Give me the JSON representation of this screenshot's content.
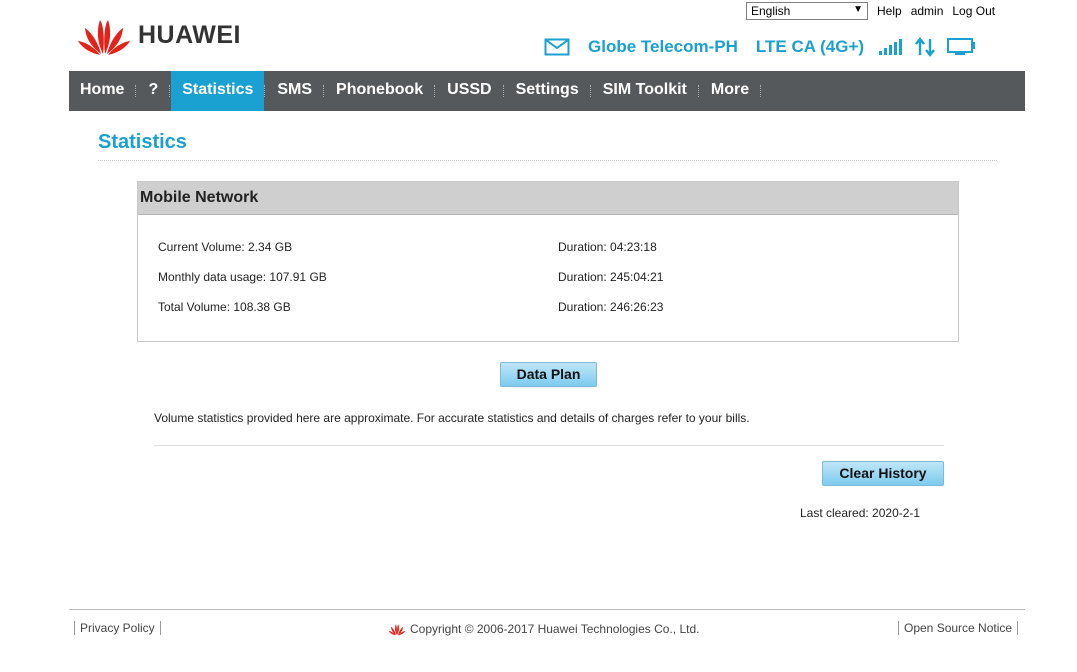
{
  "brand": {
    "logo_text": "HUAWEI",
    "color": "#e2231a"
  },
  "header": {
    "language_selected": "English",
    "links": [
      "Help",
      "admin",
      "Log Out"
    ],
    "carrier": "Globe Telecom-PH",
    "network_type": "LTE CA (4G+)",
    "icons": [
      "mail-icon",
      "signal-bars-icon",
      "data-transfer-icon",
      "monitor-icon"
    ],
    "accent": "#1aa0d1"
  },
  "nav": {
    "items": [
      "Home",
      "?",
      "Statistics",
      "SMS",
      "Phonebook",
      "USSD",
      "Settings",
      "SIM Toolkit",
      "More"
    ],
    "active": "Statistics"
  },
  "main": {
    "title": "Statistics",
    "panel_title": "Mobile Network",
    "stats": [
      {
        "label": "Current Volume: 2.34 GB",
        "duration": "Duration: 04:23:18"
      },
      {
        "label": "Monthly data usage: 107.91 GB",
        "duration": "Duration: 245:04:21"
      },
      {
        "label": "Total Volume: 108.38 GB",
        "duration": "Duration: 246:26:23"
      }
    ],
    "data_plan_button": "Data Plan",
    "note": "Volume statistics provided here are approximate. For accurate statistics and details of charges refer to your bills.",
    "clear_history_button": "Clear History",
    "last_cleared": "Last cleared: 2020-2-1"
  },
  "footer": {
    "privacy_policy": "Privacy Policy",
    "copyright": "Copyright © 2006-2017 Huawei Technologies Co., Ltd.",
    "open_source_notice": "Open Source Notice"
  }
}
